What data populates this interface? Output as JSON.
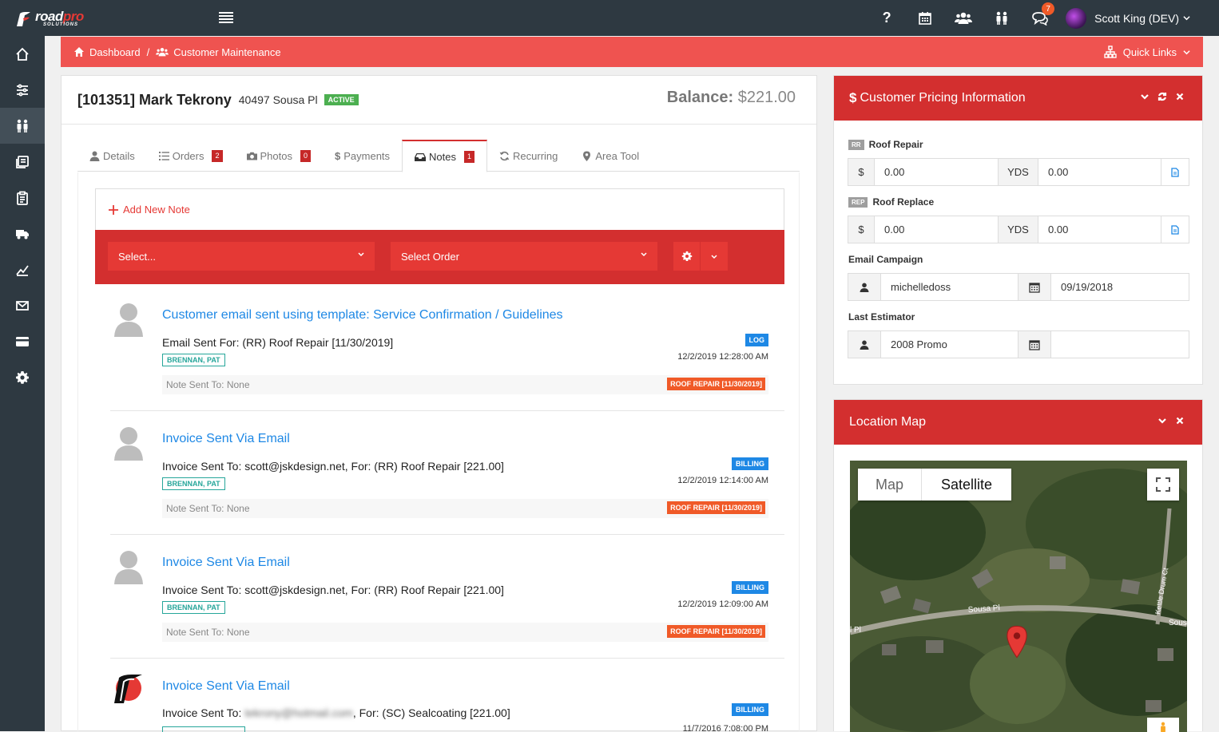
{
  "app": {
    "brand_a": "road",
    "brand_b": "pro",
    "brand_sub": "SOLUTIONS"
  },
  "topbar": {
    "help_label": "?",
    "notif_count": "7",
    "user_name": "Scott King (DEV)"
  },
  "breadcrumb": {
    "dashboard": "Dashboard",
    "sep": "/",
    "current": "Customer Maintenance",
    "quick_links": "Quick Links"
  },
  "customer": {
    "id_name": "[101351] Mark Tekrony",
    "address": "40497 Sousa Pl",
    "status": "ACTIVE",
    "balance_label": "Balance:",
    "balance_value": "$221.00"
  },
  "tabs": [
    {
      "label": "Details",
      "count": ""
    },
    {
      "label": "Orders",
      "count": "2"
    },
    {
      "label": "Photos",
      "count": "0"
    },
    {
      "label": "Payments",
      "count": ""
    },
    {
      "label": "Notes",
      "count": "1"
    },
    {
      "label": "Recurring",
      "count": ""
    },
    {
      "label": "Area Tool",
      "count": ""
    }
  ],
  "notes_toolbar": {
    "add_label": "Add New Note",
    "select_label": "Select...",
    "order_label": "Select Order"
  },
  "notes": [
    {
      "title": "Customer email sent using template: Service Confirmation / Guidelines",
      "body": "Email Sent For: (RR) Roof Repair [11/30/2019]",
      "author": "BRENNAN, PAT",
      "type": "LOG",
      "date": "12/2/2019 12:28:00 AM",
      "sent_to": "Note Sent To: None",
      "order": "ROOF REPAIR [11/30/2019]"
    },
    {
      "title": "Invoice Sent Via Email",
      "body": "Invoice Sent To: scott@jskdesign.net, For: (RR) Roof Repair [221.00]",
      "author": "BRENNAN, PAT",
      "type": "BILLING",
      "date": "12/2/2019 12:14:00 AM",
      "sent_to": "Note Sent To: None",
      "order": "ROOF REPAIR [11/30/2019]"
    },
    {
      "title": "Invoice Sent Via Email",
      "body": "Invoice Sent To: scott@jskdesign.net, For: (RR) Roof Repair [221.00]",
      "author": "BRENNAN, PAT",
      "type": "BILLING",
      "date": "12/2/2019 12:09:00 AM",
      "sent_to": "Note Sent To: None",
      "order": "ROOF REPAIR [11/30/2019]"
    },
    {
      "title": "Invoice Sent Via Email",
      "body_a": "Invoice Sent To: ",
      "body_blur": "tekrony@hotmail.com",
      "body_b": ", For: (SC) Sealcoating [221.00]",
      "type": "BILLING",
      "date": "11/7/2016 7:08:00 PM"
    }
  ],
  "pricing": {
    "title": "Customer Pricing Information",
    "rows": [
      {
        "code": "RR",
        "name": "Roof Repair",
        "cur": "$",
        "price": "0.00",
        "unit": "YDS",
        "qty": "0.00"
      },
      {
        "code": "REP",
        "name": "Roof Replace",
        "cur": "$",
        "price": "0.00",
        "unit": "YDS",
        "qty": "0.00"
      }
    ],
    "email_campaign_label": "Email Campaign",
    "email_campaign_user": "michelledoss",
    "email_campaign_date": "09/19/2018",
    "last_estimator_label": "Last Estimator",
    "last_estimator_value": "2008 Promo",
    "last_estimator_date": ""
  },
  "map": {
    "title": "Location Map",
    "map_btn": "Map",
    "satellite_btn": "Satellite",
    "street1": "Sousa Pl",
    "street2": "Kettle Drum Ct",
    "street3": "Sous",
    "street4": "l Pl"
  },
  "colors": {
    "accent": "#d32f2f",
    "sidebar": "#2e3941",
    "link": "#1e88e5",
    "teal": "#26a69a",
    "orange": "#f05a28"
  }
}
